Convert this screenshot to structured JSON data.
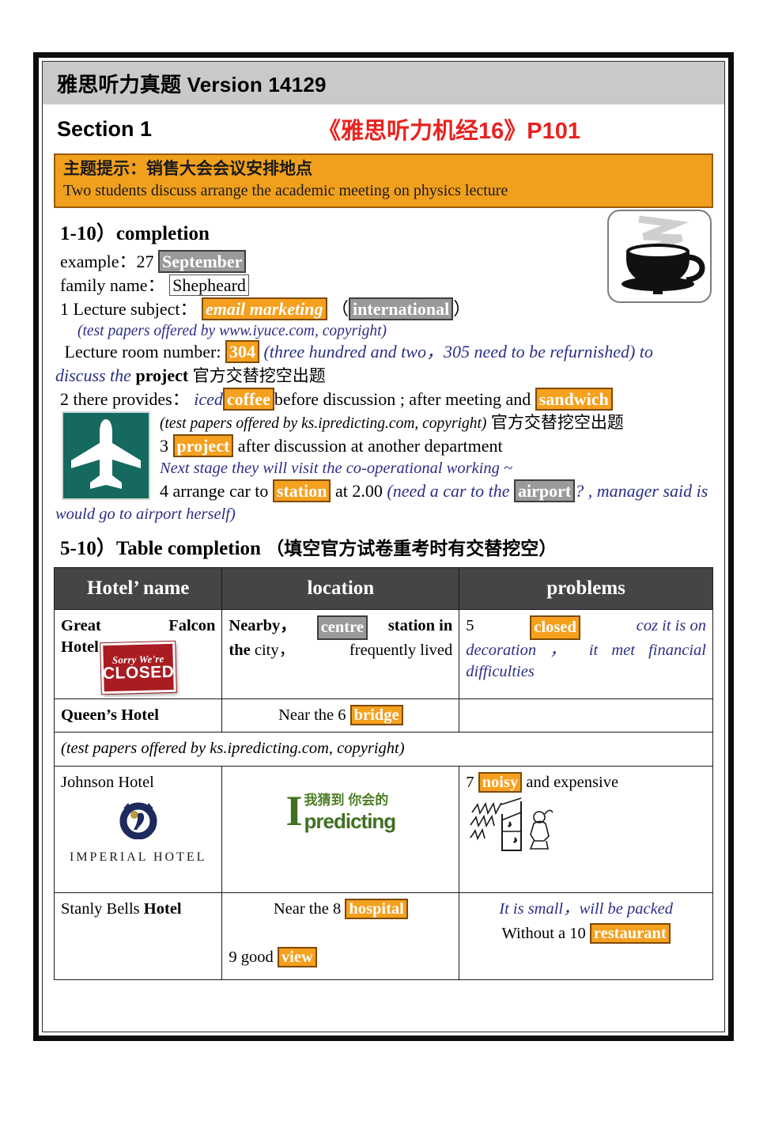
{
  "header": {
    "title": "雅思听力真题 Version 14129"
  },
  "section": {
    "label": "Section 1",
    "book_ref": "《雅思听力机经16》P101"
  },
  "banner": {
    "topic_cn": "主题提示：销售大会会议安排地点",
    "topic_en": "Two students discuss arrange the academic meeting on physics lecture",
    "bg_color": "#f1a01d",
    "border_color": "#9a5a06"
  },
  "completion": {
    "heading": "1-10）completion",
    "example_label": "example：27",
    "example_answer": "September",
    "family_label": "family name：",
    "family_answer": "Shepheard",
    "q1_label": "1 Lecture subject：",
    "q1_answer": "email marketing",
    "q1_alt": "international",
    "note1": "(test papers offered by www.iyuce.com, copyright)",
    "room_label": "Lecture room number:",
    "room_answer": "304",
    "room_note": "(three hundred and two，305 need to be refurnished) to",
    "room_cont_ital": "discuss the",
    "room_cont_bold": "project",
    "room_cont_cn": "官方交替挖空出题",
    "q2_prefix": "2   there provides：",
    "q2_iced": "iced",
    "q2_answer": "coffee",
    "q2_mid": "before discussion ; after meeting and",
    "q2_answer2": "sandwich",
    "note2": "(test papers offered by ks.ipredicting.com, copyright)",
    "note2_cn": "官方交替挖空出题",
    "q3_num": "3",
    "q3_answer": "project",
    "q3_rest": "after discussion at another department",
    "q3_note": "Next stage they will visit the co-operational working ~",
    "q4_prefix": "4 arrange car to",
    "q4_answer": "station",
    "q4_mid": "at 2.00",
    "q4_note_a": "(need a car to the",
    "q4_answer2": "airport",
    "q4_note_b": "? , manager said is",
    "q4_note_c": "would go to airport herself)"
  },
  "table_section": {
    "heading_en": "5-10）Table completion",
    "heading_cn": "（填空官方试卷重考时有交替挖空）",
    "columns": [
      "Hotel’ name",
      "location",
      "problems"
    ],
    "rows": [
      {
        "hotel_a": "Great",
        "hotel_b": "Falcon",
        "hotel_c": "Hotel",
        "sign_line1": "Sorry We're",
        "sign_line2": "CLOSED",
        "loc_a": "Nearby，",
        "loc_hl": "centre",
        "loc_b": "station in",
        "loc_c": "the",
        "loc_d": "city，",
        "loc_e": "frequently lived",
        "prob_num": "5",
        "prob_hl": "closed",
        "prob_text": "coz  it  is  on",
        "prob_text2": "decoration ，  it  met  financial",
        "prob_text3": "difficulties"
      },
      {
        "hotel_a": "Queen’s Hotel",
        "loc_a": "Near the 6",
        "loc_hl": "bridge",
        "prob_text": ""
      },
      {
        "hotel_a": "Johnson Hotel",
        "logo_name": "IMPERIAL HOTEL",
        "mid_logo_main": "predicting",
        "mid_logo_cn": "我猜到 你会的",
        "prob_num": "7",
        "prob_hl": "noisy",
        "prob_text": "and expensive"
      },
      {
        "hotel_a": "Stanly Bells",
        "hotel_b": "Hotel",
        "loc_a": "Near the 8",
        "loc_hl": "hospital",
        "loc_b": "9 good",
        "loc_hl2": "view",
        "prob_text": "It is small，will be packed",
        "prob_text2": "Without a 10",
        "prob_hl": "restaurant"
      }
    ],
    "copyright_row": "(test papers offered by ks.ipredicting.com, copyright)"
  },
  "colors": {
    "orange_highlight": "#f5a01e",
    "gray_highlight": "#9a9a9a",
    "blue_text": "#2a2f86",
    "red_title": "#e8221f",
    "table_header_bg": "#454545",
    "plane_sign_green": "#16695e"
  }
}
